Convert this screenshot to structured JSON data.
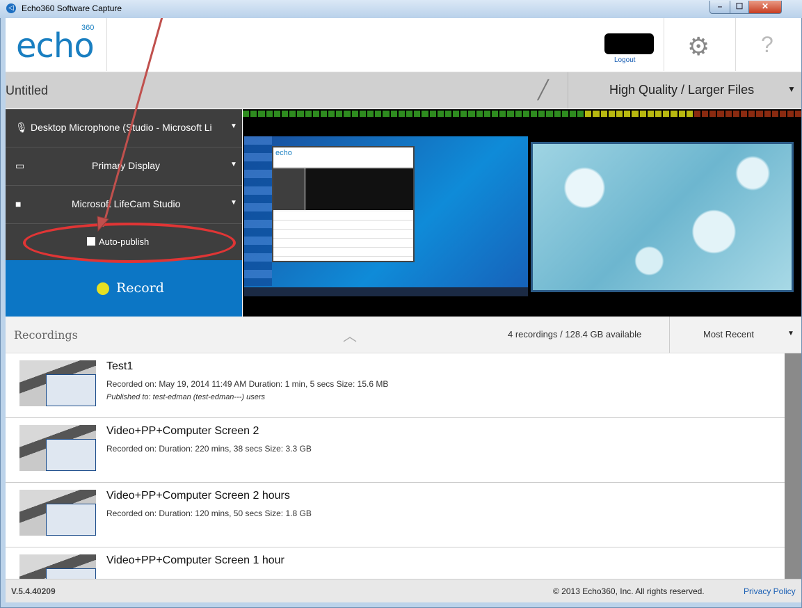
{
  "window": {
    "title": "Echo360 Software Capture",
    "min": "–",
    "max": "☐",
    "close": "✕"
  },
  "header": {
    "logo": "echo",
    "logo_sup": "360",
    "logout": "Logout",
    "settings_icon": "gear-icon",
    "help": "?"
  },
  "recording": {
    "title": "Untitled",
    "quality": "High Quality / Larger Files"
  },
  "inputs": {
    "audio": "Desktop Microphone (Studio - Microsoft Li",
    "display": "Primary Display",
    "camera": "Microsoft LifeCam Studio",
    "auto_publish": "Auto-publish",
    "record": "Record"
  },
  "recordings": {
    "header": "Recordings",
    "count": "4 recordings / 128.4 GB  available",
    "sort": "Most Recent",
    "items": [
      {
        "name": "Test1",
        "meta": "Recorded on: May 19, 2014 11:49 AM    Duration: 1 min, 5 secs    Size: 15.6 MB",
        "published": "Published to: test-edman (test-edman---) users"
      },
      {
        "name": "Video+PP+Computer Screen 2",
        "meta": "Recorded on:     Duration: 220 mins, 38 secs    Size: 3.3 GB"
      },
      {
        "name": "Video+PP+Computer Screen 2 hours",
        "meta": "Recorded on:     Duration: 120 mins, 50 secs    Size: 1.8 GB"
      },
      {
        "name": "Video+PP+Computer Screen 1 hour",
        "meta": ""
      }
    ]
  },
  "footer": {
    "version": "V.5.4.40209",
    "copyright": "© 2013 Echo360, Inc. All rights reserved.",
    "privacy": "Privacy Policy"
  },
  "colors": {
    "accent": "#0c76c5",
    "annotation": "#e03535",
    "panel": "#3e3e3e"
  }
}
